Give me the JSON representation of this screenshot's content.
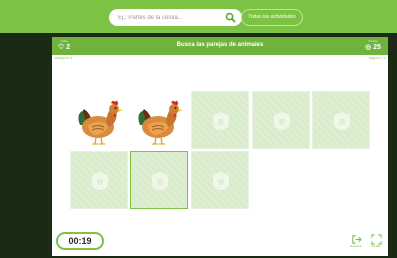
{
  "search": {
    "placeholder": "Ej.: Partes de la célula..."
  },
  "nav": {
    "all_activities": "Todas las actividades"
  },
  "game": {
    "title": "Busca las parejas de animales",
    "lives_label": "Vidas",
    "lives": "2",
    "points_label": "Puntos",
    "points": "25",
    "sub_left": "Parejas 0 / 3",
    "sub_right": "Página 1 / 1",
    "timer": "00:19",
    "exit_label": "Abandonar",
    "fullscreen_label": "Pantalla",
    "tiles": [
      {
        "state": "revealed",
        "content": "hen"
      },
      {
        "state": "revealed",
        "content": "hen"
      },
      {
        "state": "hidden",
        "content": "e-logo"
      },
      {
        "state": "hidden",
        "content": "e-logo"
      },
      {
        "state": "hidden",
        "content": "e-logo"
      },
      {
        "state": "hidden",
        "content": "e-logo"
      },
      {
        "state": "hidden",
        "content": "e-logo",
        "highlighted": true
      },
      {
        "state": "hidden",
        "content": "e-logo"
      }
    ]
  },
  "colors": {
    "brand_green": "#7cc244",
    "header_green": "#6fb23c",
    "tile_back": "#d8ebcb",
    "dark_stage": "#1a2a14"
  }
}
